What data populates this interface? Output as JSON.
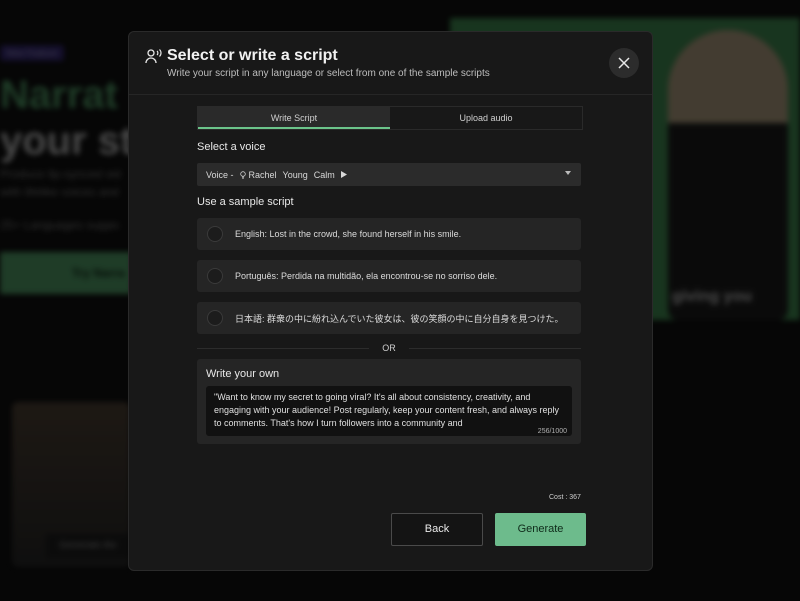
{
  "background": {
    "badge": "New Feature",
    "headline_line1": "Narrat",
    "headline_line2": "your st",
    "subtext_line1": "Produce lip-synced vid",
    "subtext_line2": "with lifelike voices and",
    "languages": "25+ Languages suppo",
    "try_button": "Try Narra",
    "video_caption": "giving you",
    "thumb_button": "Generate Aiv"
  },
  "modal": {
    "icon": "voice-speaking-icon",
    "title": "Select or write a script",
    "subtitle": "Write your script in any language or select from one of the sample scripts",
    "close_icon": "close-icon",
    "tabs": [
      {
        "label": "Write Script",
        "active": true
      },
      {
        "label": "Upload audio",
        "active": false
      }
    ],
    "voice_label": "Select a voice",
    "voice": {
      "prefix": "Voice -",
      "name": "Rachel",
      "age": "Young",
      "tone": "Calm",
      "play_icon": "play-icon",
      "dropdown_icon": "chevron-down-icon"
    },
    "sample_label": "Use a sample script",
    "samples": [
      "English: Lost in the crowd, she found herself in his smile.",
      "Português: Perdida na multidão, ela encontrou-se no sorriso dele.",
      "日本語: 群衆の中に紛れ込んでいた彼女は、彼の笑顔の中に自分自身を見つけた。"
    ],
    "or_text": "OR",
    "own_label": "Write your own",
    "script_text": "\"Want to know my secret to going viral? It's all about consistency, creativity, and engaging with your audience! Post regularly, keep your content fresh, and always reply to comments. That's how I turn followers into a community and",
    "char_count": "256/1000",
    "cost": "Cost : 367",
    "back_label": "Back",
    "generate_label": "Generate"
  },
  "colors": {
    "accent": "#6dbb8c",
    "modal_bg": "#181818",
    "panel_bg": "#252525"
  }
}
